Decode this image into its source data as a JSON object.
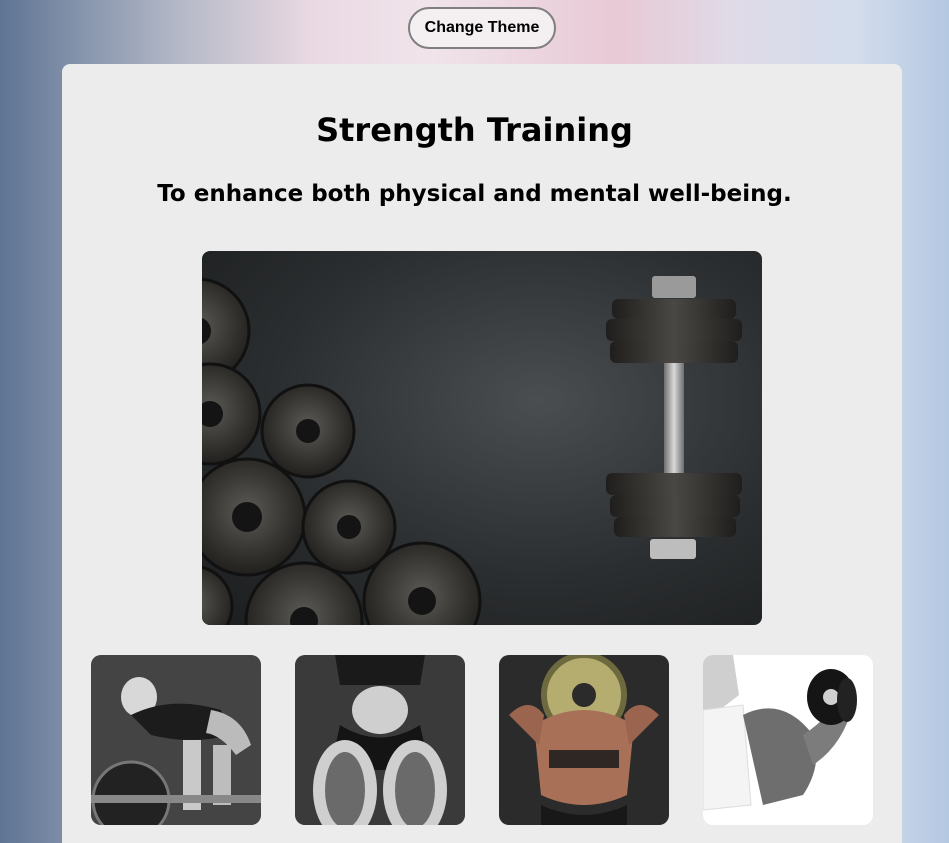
{
  "header": {
    "theme_button_label": "Change Theme"
  },
  "main": {
    "title": "Strength Training",
    "subtitle": "To enhance both physical and mental well-being."
  },
  "images": {
    "hero": "dumbbell-and-weight-plates-photo",
    "thumbnails": [
      "woman-deadlift-barbell-photo",
      "woman-kettlebell-sneakers-photo",
      "woman-back-holding-plate-photo",
      "woman-dumbbell-curl-photo"
    ]
  },
  "colors": {
    "card_bg": "#ececec",
    "button_border": "#7f7f7f"
  }
}
